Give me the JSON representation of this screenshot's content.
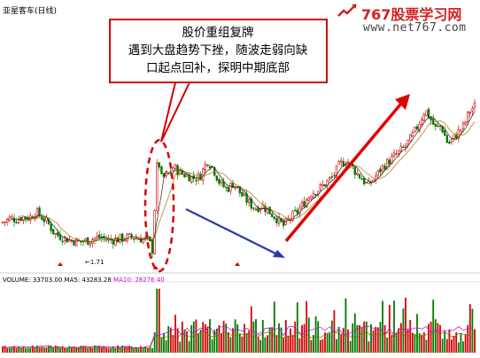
{
  "header": {
    "stock_title": "亚星客车(日线)",
    "brand_name": "767股票学习网",
    "site_url": "www.net767.com"
  },
  "callout": {
    "lines": [
      "股价重组复牌",
      "遇到大盘趋势下挫，随波走弱向缺",
      "口起点回补，探明中期底部"
    ]
  },
  "volume_legend": {
    "volume": "VOLUME: 33703.00",
    "ma5": "MA5: 43283.28",
    "ma10": "MA10: 28276.40"
  },
  "low_marker": "←1.71",
  "colors": {
    "up": "#d40000",
    "down": "#007a00",
    "callout_border": "#d40000",
    "down_arrow": "#2a3aa8",
    "up_arrow": "#e00000",
    "ma5": "#d400d4",
    "ma10": "#707000"
  },
  "chart_data": {
    "type": "candlestick",
    "note_arrows": [
      "down-trend after resumption",
      "up-trend from mid-term bottom"
    ],
    "price_path": [
      [
        0,
        0.27
      ],
      [
        6,
        0.28
      ],
      [
        12,
        0.3
      ],
      [
        18,
        0.29
      ],
      [
        25,
        0.31
      ],
      [
        33,
        0.3
      ],
      [
        40,
        0.34
      ],
      [
        48,
        0.3
      ],
      [
        55,
        0.26
      ],
      [
        62,
        0.2
      ],
      [
        70,
        0.18
      ],
      [
        80,
        0.16
      ],
      [
        90,
        0.15
      ],
      [
        100,
        0.16
      ],
      [
        112,
        0.18
      ],
      [
        124,
        0.16
      ],
      [
        136,
        0.17
      ],
      [
        148,
        0.18
      ],
      [
        160,
        0.17
      ],
      [
        168,
        0.16
      ],
      [
        172,
        0.1
      ],
      [
        178,
        0.7
      ],
      [
        182,
        0.55
      ],
      [
        188,
        0.56
      ],
      [
        196,
        0.62
      ],
      [
        204,
        0.58
      ],
      [
        210,
        0.57
      ],
      [
        218,
        0.55
      ],
      [
        226,
        0.56
      ],
      [
        234,
        0.66
      ],
      [
        240,
        0.62
      ],
      [
        248,
        0.52
      ],
      [
        256,
        0.48
      ],
      [
        264,
        0.52
      ],
      [
        272,
        0.45
      ],
      [
        280,
        0.4
      ],
      [
        288,
        0.36
      ],
      [
        296,
        0.38
      ],
      [
        304,
        0.34
      ],
      [
        312,
        0.3
      ],
      [
        320,
        0.25
      ],
      [
        328,
        0.3
      ],
      [
        336,
        0.34
      ],
      [
        344,
        0.4
      ],
      [
        352,
        0.46
      ],
      [
        360,
        0.48
      ],
      [
        368,
        0.52
      ],
      [
        376,
        0.56
      ],
      [
        384,
        0.64
      ],
      [
        392,
        0.66
      ],
      [
        400,
        0.6
      ],
      [
        408,
        0.55
      ],
      [
        416,
        0.5
      ],
      [
        424,
        0.56
      ],
      [
        432,
        0.62
      ],
      [
        440,
        0.66
      ],
      [
        448,
        0.7
      ],
      [
        456,
        0.74
      ],
      [
        464,
        0.8
      ],
      [
        472,
        0.88
      ],
      [
        480,
        0.98
      ],
      [
        486,
        0.92
      ],
      [
        492,
        0.86
      ],
      [
        498,
        0.88
      ],
      [
        506,
        0.76
      ],
      [
        512,
        0.8
      ],
      [
        518,
        0.84
      ],
      [
        524,
        0.88
      ],
      [
        530,
        0.97
      ],
      [
        536,
        1.0
      ]
    ],
    "x_range": [
      0,
      540
    ],
    "y_range": [
      0,
      1
    ],
    "series_labels": [
      "VOLUME",
      "MA5",
      "MA10"
    ]
  }
}
